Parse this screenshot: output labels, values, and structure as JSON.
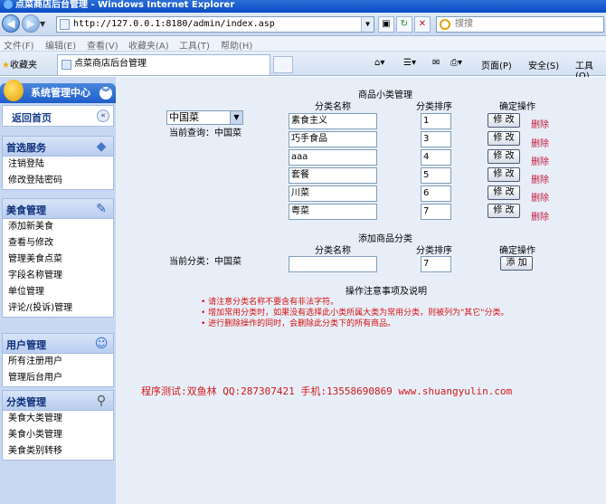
{
  "window": {
    "title": "点菜商店后台管理 - Windows Internet Explorer"
  },
  "browser": {
    "address": "http://127.0.0.1:8180/admin/index.asp",
    "search_placeholder": "搜搜",
    "menu": [
      "文件(F)",
      "编辑(E)",
      "查看(V)",
      "收藏夹(A)",
      "工具(T)",
      "帮助(H)"
    ],
    "favorites_label": "收藏夹",
    "tab_title": "点菜商店后台管理",
    "tools": [
      "页面(P)",
      "安全(S)",
      "工具(O)"
    ]
  },
  "sidebar": {
    "header": "系统管理中心",
    "home": "返回首页",
    "groups": [
      {
        "title": "首选服务",
        "icon": "shopping-icon",
        "items": [
          "注销登陆",
          "修改登陆密码"
        ]
      },
      {
        "title": "美食管理",
        "icon": "edit-icon",
        "items": [
          "添加新美食",
          "查看与修改",
          "管理美食点菜",
          "字段名称管理",
          "单位管理",
          "评论/(投诉)管理"
        ]
      },
      {
        "title": "用户管理",
        "icon": "user-icon",
        "items": [
          "所有注册用户",
          "管理后台用户"
        ]
      },
      {
        "title": "分类管理",
        "icon": "search-icon",
        "items": [
          "美食大类管理",
          "美食小类管理",
          "美食类别转移"
        ]
      }
    ]
  },
  "main": {
    "list_title": "商品小类管理",
    "col_name": "分类名称",
    "col_order": "分类排序",
    "col_action": "确定操作",
    "category_select": "中国菜",
    "current_query": "当前查询：中国菜",
    "rows": [
      {
        "name": "素食主义",
        "order": "1"
      },
      {
        "name": "巧手食品",
        "order": "3"
      },
      {
        "name": "aaa",
        "order": "4"
      },
      {
        "name": "套餐",
        "order": "5"
      },
      {
        "name": "川菜",
        "order": "6"
      },
      {
        "name": "粤菜",
        "order": "7"
      }
    ],
    "modify_label": "修 改",
    "delete_label": "删除",
    "add_title": "添加商品分类",
    "current_category": "当前分类：中国菜",
    "add_order_value": "7",
    "add_label": "添 加",
    "notes_title": "操作注意事项及说明",
    "notes": [
      "• 请注意分类名称不要含有非法字符。",
      "• 增加常用分类时，如果没有选择此小类所属大类为常用分类，则被列为\"其它\"分类。",
      "• 进行删除操作的同时，会删除此分类下的所有商品。"
    ],
    "credit": "程序测试:双鱼林 QQ:287307421 手机:13558690869 www.shuangyulin.com"
  }
}
